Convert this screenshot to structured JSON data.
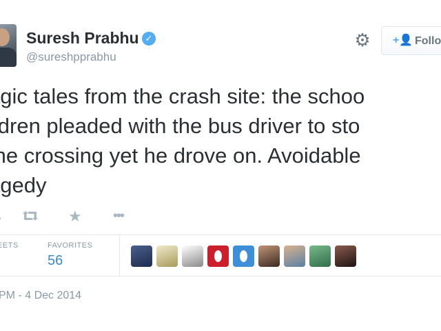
{
  "profile": {
    "name": "Suresh Prabhu",
    "handle": "@sureshpprabhu",
    "verified_badge_icon": "verified-checkmark-icon"
  },
  "header": {
    "settings_icon": "gear-icon",
    "follow_icon": "add-user-icon",
    "follow_label": "Follo"
  },
  "tweet": {
    "lines": [
      "agic tales from the crash site: the schoo",
      "ildren pleaded with the bus driver to sto",
      " the crossing yet he drove on. Avoidable",
      "agedy"
    ]
  },
  "actions": {
    "icons": [
      "reply-icon",
      "retweet-icon",
      "favorite-star-icon",
      "more-options-icon"
    ]
  },
  "stats": {
    "retweets_label": "EETS",
    "favorites_label": "FAVORITES",
    "favorites_value": "56"
  },
  "favoriters": [
    {
      "colors": [
        "#4a5f8a",
        "#1d2b4d"
      ]
    },
    {
      "colors": [
        "#efe9c9",
        "#a89a5c"
      ]
    },
    {
      "colors": [
        "#ffffff",
        "#8a8a8a"
      ]
    },
    {
      "colors": [
        "#cc1f2d",
        "#cc1f2d"
      ],
      "brand": true
    },
    {
      "colors": [
        "#3f8fd8",
        "#3f8fd8"
      ],
      "brand": true
    },
    {
      "colors": [
        "#c19376",
        "#3a2b22"
      ]
    },
    {
      "colors": [
        "#d9b28f",
        "#5a7fa3"
      ]
    },
    {
      "colors": [
        "#79b889",
        "#2f6e4a"
      ]
    },
    {
      "colors": [
        "#8a5a4c",
        "#1e1414"
      ]
    }
  ],
  "timestamp": "PM - 4 Dec 2014",
  "colors": {
    "text": "#292f33",
    "muted": "#8899a6",
    "link_blue": "#3b88c3",
    "verified_blue": "#55acee",
    "border": "#e1e8ed",
    "icon_gray": "#aab8c2"
  }
}
